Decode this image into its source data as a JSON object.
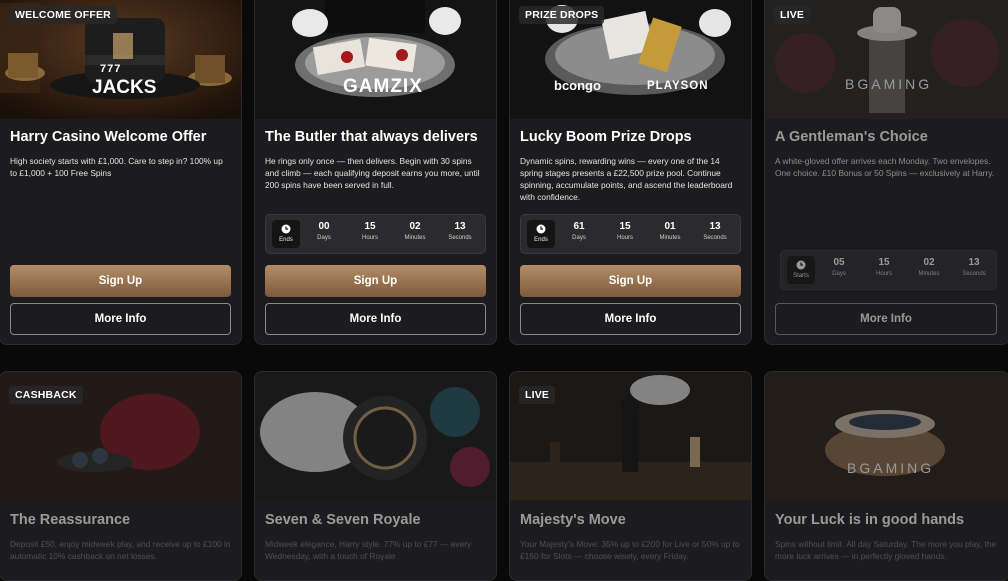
{
  "cards": [
    {
      "badge": "WELCOME OFFER",
      "brand": "JACKS",
      "brand_top": "777",
      "title": "Harry Casino Welcome Offer",
      "desc": "High society starts with £1,000. Care to step in? 100% up to £1,000 + 100 Free Spins",
      "primary": "Sign Up",
      "secondary": "More Info"
    },
    {
      "brand": "GAMZIX",
      "title": "The Butler that always delivers",
      "desc": "He rings only once — then delivers. Begin with 30 spins and climb — each qualifying deposit earns you more, until 200 spins have been served in full.",
      "timer": {
        "label": "Ends",
        "days": "00",
        "hours": "15",
        "minutes": "02",
        "seconds": "13"
      },
      "primary": "Sign Up",
      "secondary": "More Info"
    },
    {
      "badge": "PRIZE DROPS",
      "brand": "bcongo",
      "brand2": "PLAYSON",
      "title": "Lucky Boom Prize Drops",
      "desc": "Dynamic spins, rewarding wins — every one of the 14 spring stages presents a £22,500 prize pool. Continue spinning, accumulate points, and ascend the leaderboard with confidence.",
      "timer": {
        "label": "Ends",
        "days": "61",
        "hours": "15",
        "minutes": "01",
        "seconds": "13"
      },
      "primary": "Sign Up",
      "secondary": "More Info"
    },
    {
      "badge": "LIVE",
      "brand": "BGAMING",
      "title": "A Gentleman's Choice",
      "desc": "A white-gloved offer arrives each Monday. Two envelopes. One choice. £10 Bonus or 50 Spins — exclusively at Harry.",
      "timer": {
        "label": "Starts",
        "days": "05",
        "hours": "15",
        "minutes": "02",
        "seconds": "13"
      },
      "secondary": "More Info"
    },
    {
      "badge": "CASHBACK",
      "title": "The Reassurance",
      "desc": "Deposit £50, enjoy midweek play, and receive up to £100 in automatic 10% cashback on net losses."
    },
    {
      "title": "Seven & Seven Royale",
      "desc": "Midweek elegance, Harry style. 77% up to £77 — every Wednesday, with a touch of Royale"
    },
    {
      "badge": "LIVE",
      "title": "Majesty's Move",
      "desc": "Your Majesty's Move: 35% up to £200 for Live or 50% up to £150 for Slots — choose wisely, every Friday."
    },
    {
      "brand": "BGAMING",
      "title": "Your Luck is in good hands",
      "desc": "Spins without limit. All day Saturday. The more you play, the more luck arrives — in perfectly gloved hands."
    }
  ],
  "timer_labels": {
    "days": "Days",
    "hours": "Hours",
    "minutes": "Minutes",
    "seconds": "Seconds"
  }
}
